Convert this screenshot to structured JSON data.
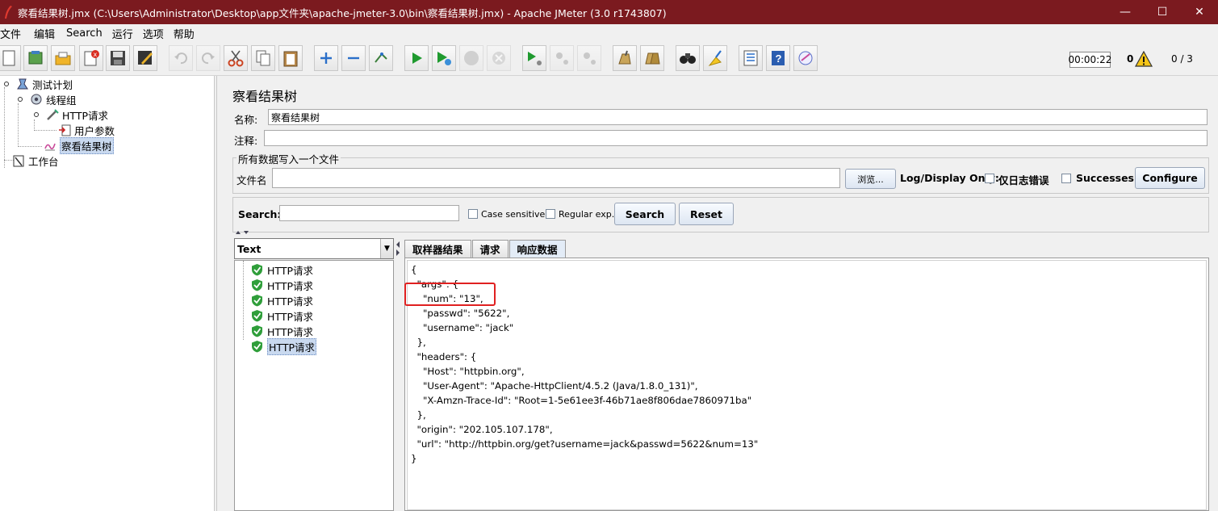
{
  "window": {
    "title": "察看结果树.jmx (C:\\Users\\Administrator\\Desktop\\app文件夹\\apache-jmeter-3.0\\bin\\察看结果树.jmx) - Apache JMeter (3.0 r1743807)",
    "minimize": "—",
    "maximize": "☐",
    "close": "✕"
  },
  "menu": [
    "文件",
    "编辑",
    "Search",
    "运行",
    "选项",
    "帮助"
  ],
  "status": {
    "elapsed": "00:00:22",
    "errors": "0",
    "threads": "0 / 3"
  },
  "tree": {
    "items": [
      {
        "label": "测试计划",
        "icon": "test-plan-icon"
      },
      {
        "label": "线程组",
        "icon": "thread-group-icon"
      },
      {
        "label": "HTTP请求",
        "icon": "http-sampler-icon"
      },
      {
        "label": "用户参数",
        "icon": "user-parameters-icon"
      },
      {
        "label": "察看结果树",
        "icon": "view-results-tree-icon"
      },
      {
        "label": "工作台",
        "icon": "workbench-icon"
      }
    ]
  },
  "panel": {
    "title": "察看结果树",
    "name_label": "名称:",
    "name_value": "察看结果树",
    "comment_label": "注释:",
    "comment_value": "",
    "file_group_legend": "所有数据写入一个文件",
    "filename_label": "文件名",
    "filename_value": "",
    "browse_button": "浏览...",
    "log_display_label": "Log/Display Only:",
    "errors_only_label": "仅日志错误",
    "successes_label": "Successes",
    "configure_button": "Configure"
  },
  "search": {
    "label": "Search:",
    "value": "",
    "case_sensitive_label": "Case sensitive",
    "regex_label": "Regular exp.",
    "search_button": "Search",
    "reset_button": "Reset"
  },
  "results": {
    "renderer": "Text",
    "samples": [
      "HTTP请求",
      "HTTP请求",
      "HTTP请求",
      "HTTP请求",
      "HTTP请求",
      "HTTP请求"
    ],
    "tabs": [
      "取样器结果",
      "请求",
      "响应数据"
    ],
    "active_tab": "响应数据",
    "response_lines": [
      "{",
      "  \"args\": {",
      "    \"num\": \"13\",",
      "    \"passwd\": \"5622\",",
      "    \"username\": \"jack\"",
      "  },",
      "  \"headers\": {",
      "    \"Host\": \"httpbin.org\",",
      "    \"User-Agent\": \"Apache-HttpClient/4.5.2 (Java/1.8.0_131)\",",
      "    \"X-Amzn-Trace-Id\": \"Root=1-5e61ee3f-46b71ae8f806dae7860971ba\"",
      "  },",
      "  \"origin\": \"202.105.107.178\",",
      "  \"url\": \"http://httpbin.org/get?username=jack&passwd=5622&num=13\"",
      "}"
    ]
  },
  "colors": {
    "titlebar": "#7b1a1f",
    "highlight": "#e02020",
    "selection": "#c9d9ef"
  }
}
